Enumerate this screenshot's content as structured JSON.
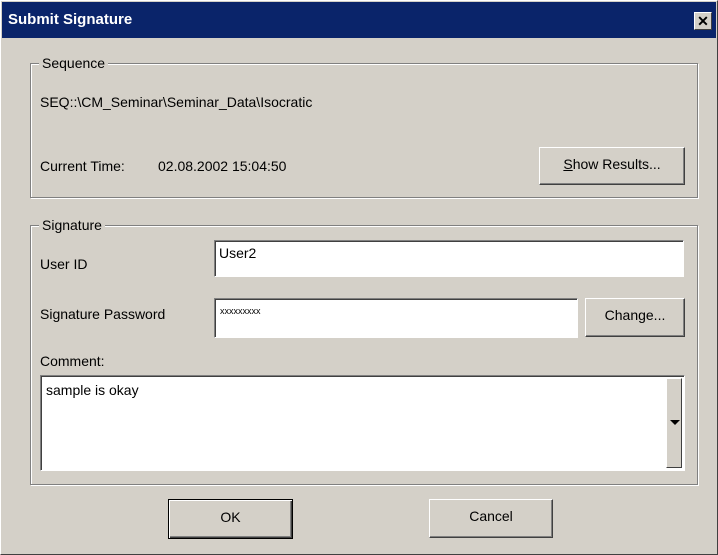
{
  "window": {
    "title": "Submit Signature",
    "close_glyph": "✕"
  },
  "sequence": {
    "legend": "Sequence",
    "path": "SEQ::\\CM_Seminar\\Seminar_Data\\Isocratic",
    "time_label": "Current Time:",
    "time_value": "02.08.2002 15:04:50",
    "show_results": {
      "mnemonic": "S",
      "rest": "how Results..."
    }
  },
  "signature": {
    "legend": "Signature",
    "user_id_label": "User ID",
    "user_id_value": "User2",
    "password_label": "Signature Password",
    "password_value": "xxxxxxxxx",
    "change_button": "Change...",
    "comment_label": "Comment:",
    "comment_value": "sample is okay"
  },
  "buttons": {
    "ok": "OK",
    "cancel": "Cancel"
  },
  "colors": {
    "face": "#d4d0c8",
    "titlebar": "#0a246a",
    "title_text": "#ffffff"
  },
  "icons": {
    "close": "close-icon",
    "dropdown": "chevron-down-icon"
  }
}
